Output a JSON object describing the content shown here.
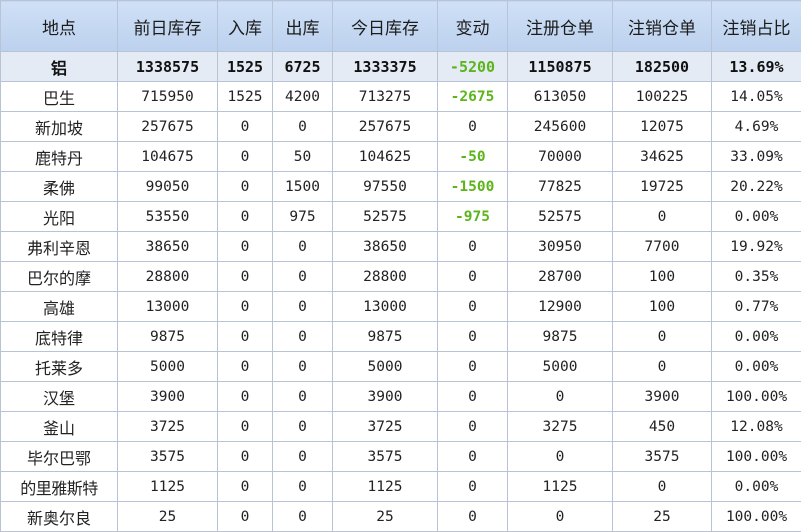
{
  "table": {
    "headers": [
      "地点",
      "前日库存",
      "入库",
      "出库",
      "今日库存",
      "变动",
      "注册仓单",
      "注销仓单",
      "注销占比"
    ],
    "summary": [
      "铝",
      "1338575",
      "1525",
      "6725",
      "1333375",
      "-5200",
      "1150875",
      "182500",
      "13.69%"
    ],
    "rows": [
      [
        "巴生",
        "715950",
        "1525",
        "4200",
        "713275",
        "-2675",
        "613050",
        "100225",
        "14.05%"
      ],
      [
        "新加坡",
        "257675",
        "0",
        "0",
        "257675",
        "0",
        "245600",
        "12075",
        "4.69%"
      ],
      [
        "鹿特丹",
        "104675",
        "0",
        "50",
        "104625",
        "-50",
        "70000",
        "34625",
        "33.09%"
      ],
      [
        "柔佛",
        "99050",
        "0",
        "1500",
        "97550",
        "-1500",
        "77825",
        "19725",
        "20.22%"
      ],
      [
        "光阳",
        "53550",
        "0",
        "975",
        "52575",
        "-975",
        "52575",
        "0",
        "0.00%"
      ],
      [
        "弗利辛恩",
        "38650",
        "0",
        "0",
        "38650",
        "0",
        "30950",
        "7700",
        "19.92%"
      ],
      [
        "巴尔的摩",
        "28800",
        "0",
        "0",
        "28800",
        "0",
        "28700",
        "100",
        "0.35%"
      ],
      [
        "高雄",
        "13000",
        "0",
        "0",
        "13000",
        "0",
        "12900",
        "100",
        "0.77%"
      ],
      [
        "底特律",
        "9875",
        "0",
        "0",
        "9875",
        "0",
        "9875",
        "0",
        "0.00%"
      ],
      [
        "托莱多",
        "5000",
        "0",
        "0",
        "5000",
        "0",
        "5000",
        "0",
        "0.00%"
      ],
      [
        "汉堡",
        "3900",
        "0",
        "0",
        "3900",
        "0",
        "0",
        "3900",
        "100.00%"
      ],
      [
        "釜山",
        "3725",
        "0",
        "0",
        "3725",
        "0",
        "3275",
        "450",
        "12.08%"
      ],
      [
        "毕尔巴鄂",
        "3575",
        "0",
        "0",
        "3575",
        "0",
        "0",
        "3575",
        "100.00%"
      ],
      [
        "的里雅斯特",
        "1125",
        "0",
        "0",
        "1125",
        "0",
        "1125",
        "0",
        "0.00%"
      ],
      [
        "新奥尔良",
        "25",
        "0",
        "0",
        "25",
        "0",
        "0",
        "25",
        "100.00%"
      ]
    ]
  },
  "colors": {
    "header_bg": "#c6d9f1",
    "summary_bg": "#e4ebf5",
    "negative_text": "#5cb51a",
    "border": "#b8c4d6"
  }
}
